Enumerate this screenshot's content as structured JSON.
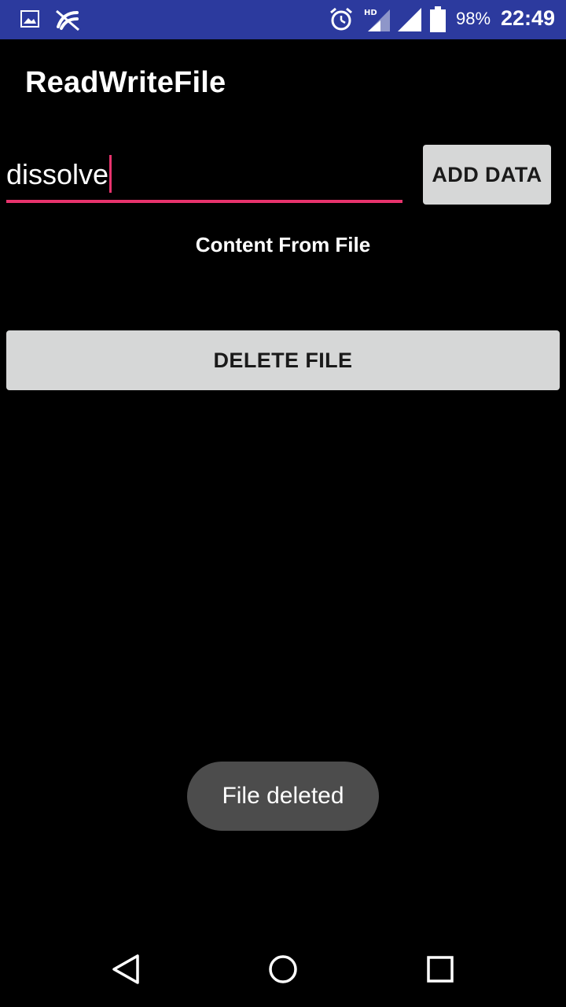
{
  "status_bar": {
    "battery_percent": "98%",
    "time": "22:49",
    "icons": [
      "image-icon",
      "no-sync-icon",
      "alarm-icon",
      "hd-signal-icon",
      "signal-icon",
      "battery-icon"
    ],
    "background_color": "#2c3a9e"
  },
  "app": {
    "title": "ReadWriteFile"
  },
  "form": {
    "input_value": "dissolve",
    "add_button_label": "ADD DATA",
    "content_label": "Content From File",
    "delete_button_label": "DELETE FILE",
    "accent_color": "#e8336d"
  },
  "toast": {
    "message": "File deleted"
  },
  "nav_bar": {
    "icons": [
      "back-icon",
      "home-icon",
      "recents-icon"
    ]
  }
}
